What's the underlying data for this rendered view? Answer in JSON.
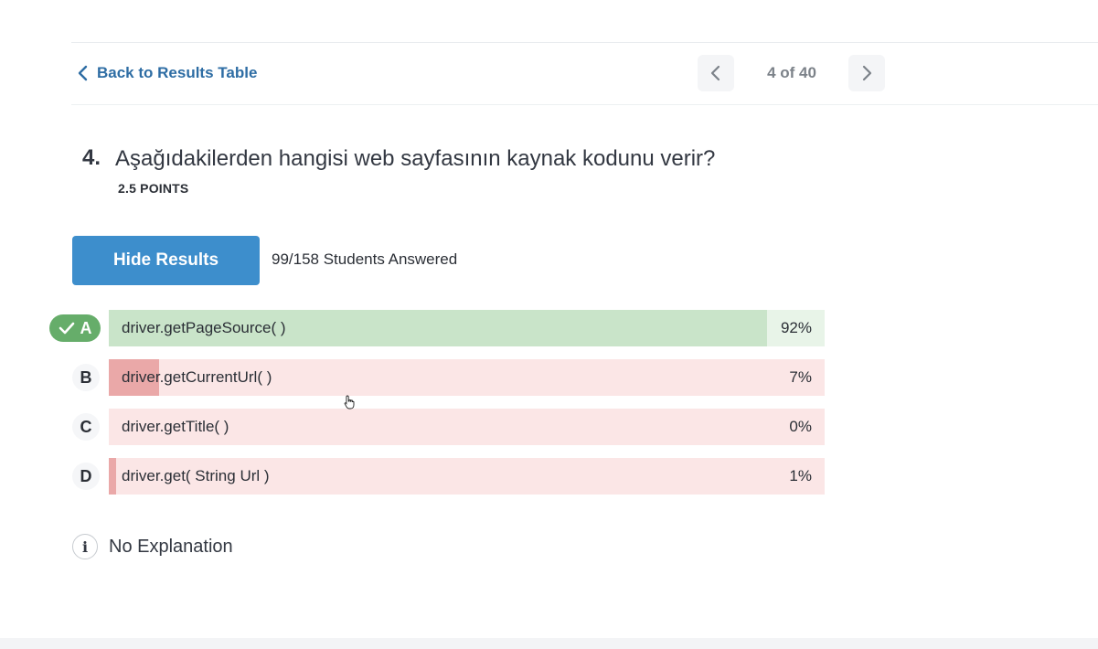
{
  "nav": {
    "back_label": "Back to Results Table",
    "pager": "4 of 40"
  },
  "question": {
    "number": "4.",
    "title": "Aşağıdakilerden hangisi web sayfasının kaynak kodunu verir?",
    "points": "2.5 POINTS"
  },
  "results": {
    "toggle_label": "Hide Results",
    "answered": "99/158 Students Answered"
  },
  "options": [
    {
      "letter": "A",
      "text": "driver.getPageSource( )",
      "percent_label": "92%",
      "percent": 92,
      "correct": true
    },
    {
      "letter": "B",
      "text": "driver.getCurrentUrl( )",
      "percent_label": "7%",
      "percent": 7,
      "correct": false
    },
    {
      "letter": "C",
      "text": "driver.getTitle( )",
      "percent_label": "0%",
      "percent": 0,
      "correct": false
    },
    {
      "letter": "D",
      "text": "driver.get( String Url )",
      "percent_label": "1%",
      "percent": 1,
      "correct": false
    }
  ],
  "explanation": {
    "icon_glyph": "i",
    "text": "No Explanation"
  },
  "colors": {
    "accent": "#3d8ecc",
    "link": "#2e6da4",
    "correct": "#66ad6a",
    "wrong_fill": "#eaa8a8",
    "wrong_bg": "#fbe6e6"
  }
}
